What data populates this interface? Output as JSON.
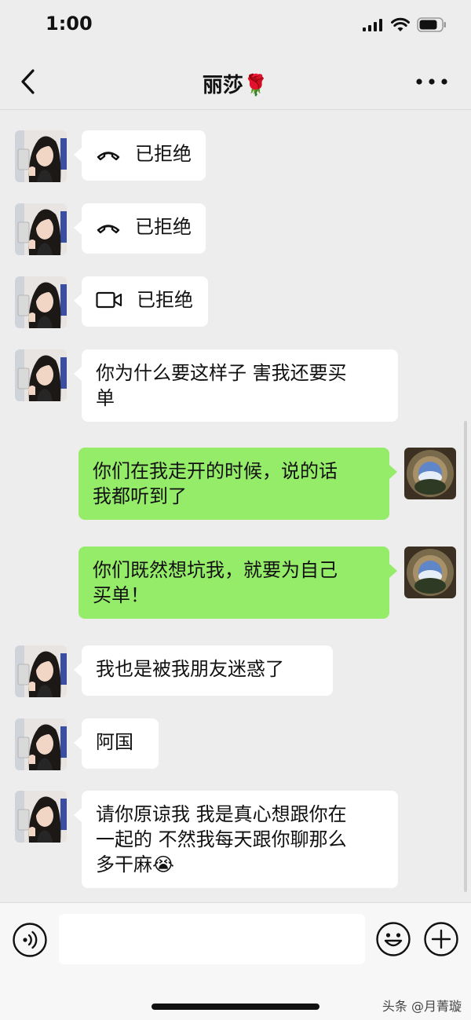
{
  "status_bar": {
    "time": "1:00"
  },
  "nav": {
    "title": "丽莎🌹"
  },
  "messages": [
    {
      "side": "in",
      "type": "call",
      "call_kind": "voice",
      "text": "已拒绝"
    },
    {
      "side": "in",
      "type": "call",
      "call_kind": "voice",
      "text": "已拒绝"
    },
    {
      "side": "in",
      "type": "call",
      "call_kind": "video",
      "text": "已拒绝"
    },
    {
      "side": "in",
      "type": "text",
      "lines": [
        "你为什么要这样子 害我还要买",
        "单"
      ]
    },
    {
      "side": "out",
      "type": "text",
      "lines": [
        "你们在我走开的时候，说的话",
        "我都听到了"
      ]
    },
    {
      "side": "out",
      "type": "text",
      "lines": [
        "你们既然想坑我，就要为自己",
        "买单！"
      ]
    },
    {
      "side": "in",
      "type": "text",
      "lines": [
        "我也是被我朋友迷惑了"
      ]
    },
    {
      "side": "in",
      "type": "text",
      "lines": [
        "阿国"
      ]
    },
    {
      "side": "in",
      "type": "text",
      "lines": [
        "请你原谅我 我是真心想跟你在",
        "一起的 不然我每天跟你聊那么",
        "多干麻😭"
      ]
    }
  ],
  "input": {
    "value": ""
  },
  "watermark": "头条 @月菁璇",
  "colors": {
    "background": "#ededed",
    "incoming_bubble": "#ffffff",
    "outgoing_bubble": "#95ec69",
    "input_bar": "#f7f7f7"
  },
  "icons": {
    "back": "chevron-left-icon",
    "more": "more-dots-icon",
    "voice_call": "phone-hangup-icon",
    "video_call": "video-camera-icon",
    "voice_input": "voice-input-icon",
    "emoji": "emoji-icon",
    "plus": "plus-icon"
  }
}
